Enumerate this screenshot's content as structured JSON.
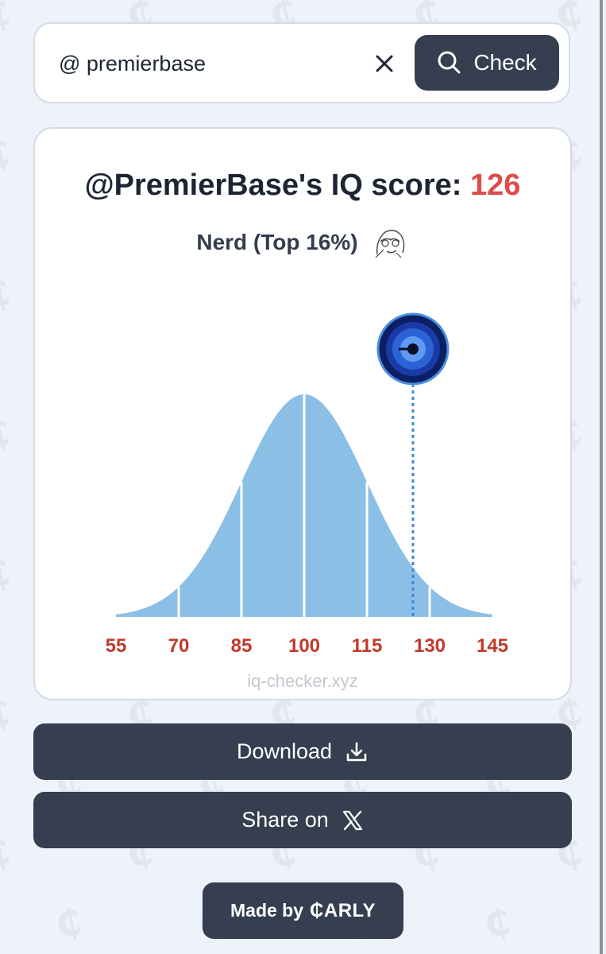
{
  "search": {
    "prefix": "@",
    "value": "premierbase",
    "check_label": "Check"
  },
  "result": {
    "title_prefix": "@PremierBase's IQ score: ",
    "score": "126",
    "category": "Nerd (Top 16%)"
  },
  "chart_data": {
    "type": "area",
    "x_ticks": [
      "55",
      "70",
      "85",
      "100",
      "115",
      "130",
      "145"
    ],
    "xlim": [
      55,
      145
    ],
    "mean": 100,
    "sd": 15,
    "marker_value": 126,
    "fill_color": "#8bbfe6",
    "marker_line_color": "#3a8ad8",
    "tick_color": "#c0392b"
  },
  "footer": {
    "site": "iq-checker.xyz"
  },
  "actions": {
    "download_label": "Download",
    "share_label": "Share on"
  },
  "made_by": {
    "label": "Made by",
    "brand": "₵ARLY"
  },
  "colors": {
    "score": "#e14a48",
    "button_bg": "#363f4f",
    "background": "#eef2fa"
  }
}
